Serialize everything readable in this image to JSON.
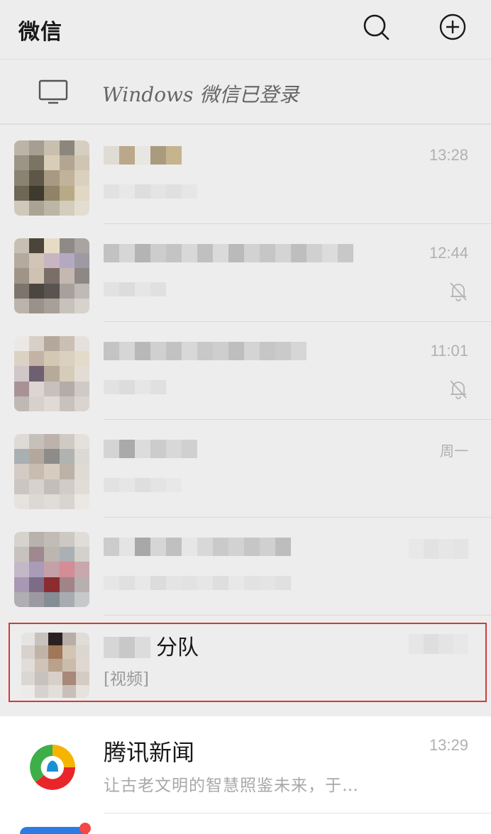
{
  "header": {
    "title": "微信",
    "search_icon": "search-icon",
    "add_icon": "plus-circle-icon"
  },
  "login_bar": {
    "icon": "monitor-icon",
    "text": "Windows 微信已登录"
  },
  "chats": [
    {
      "time": "13:28",
      "muted": false
    },
    {
      "time": "12:44",
      "muted": true
    },
    {
      "time": "11:01",
      "muted": true
    },
    {
      "time": "周一",
      "muted": false
    },
    {
      "time": "",
      "muted": false
    }
  ],
  "highlighted_chat": {
    "name_suffix": "分队",
    "preview": "[视频]"
  },
  "news_chat": {
    "name": "腾讯新闻",
    "preview": "让古老文明的智慧照鉴未来，于…",
    "time": "13:29"
  },
  "colors": {
    "background": "#ededed",
    "highlight_border": "#d33a3a",
    "news_row": "#ffffff"
  }
}
